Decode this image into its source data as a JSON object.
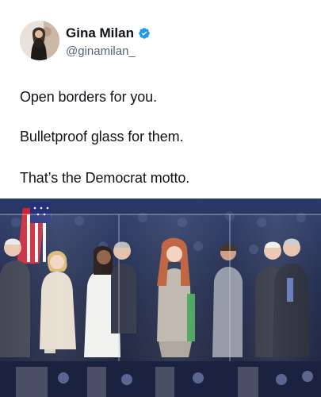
{
  "user": {
    "display_name": "Gina Milan",
    "handle": "@ginamilan_",
    "verified_icon": "verified-badge-icon",
    "verified_color": "#1d9bf0"
  },
  "tweet": {
    "lines": [
      "Open borders for you.",
      "Bulletproof glass for them.",
      "That’s the Democrat motto."
    ]
  },
  "photo": {
    "subject": "people-standing-behind-glass-photo"
  },
  "colors": {
    "text": "#0f1419",
    "secondary": "#536471",
    "accent": "#1d9bf0"
  }
}
